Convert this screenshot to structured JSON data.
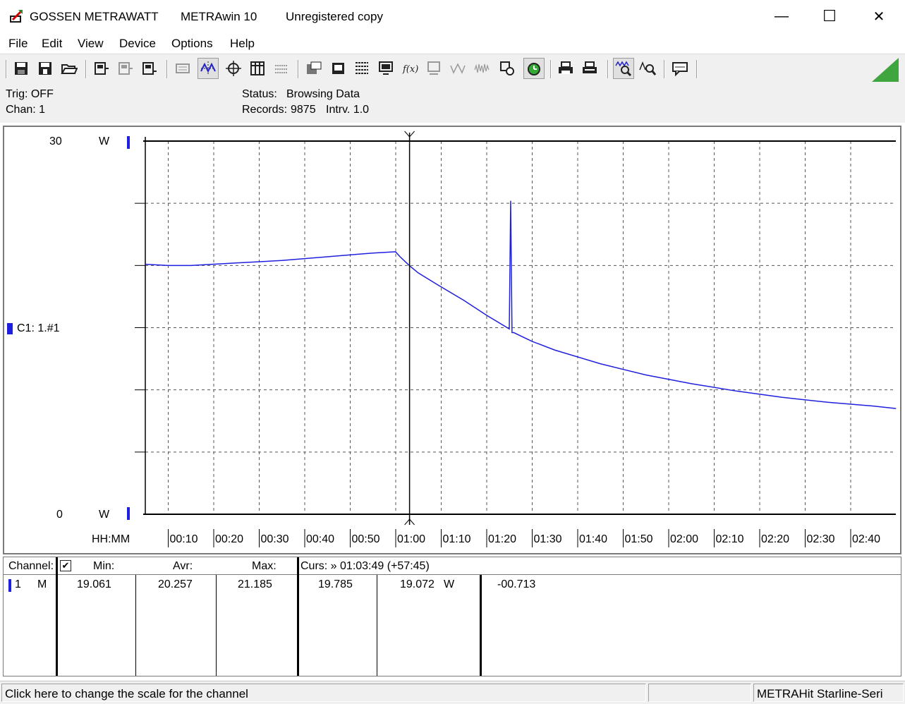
{
  "window": {
    "brand": "GOSSEN METRAWATT",
    "app_name": "METRAwin 10",
    "registration": "Unregistered copy",
    "minimize_glyph": "—",
    "maximize_glyph": "☐",
    "close_glyph": "✕"
  },
  "menu": [
    "File",
    "Edit",
    "View",
    "Device",
    "Options",
    "Help"
  ],
  "toolbar_icons": [
    "save-icon",
    "save-as-icon",
    "open-folder-icon",
    "device-read-icon",
    "device-write-icon",
    "device-config-icon",
    "display-icon",
    "waveform-icon",
    "crosshair-icon",
    "table-icon",
    "list-icon",
    "chart-config-icon",
    "window-icon",
    "data-grid-icon",
    "monitor-icon",
    "function-icon",
    "printer-small-icon",
    "wave-icon",
    "noise-icon",
    "settings-icon",
    "clock-gear-icon",
    "print-icon",
    "print-preview-icon",
    "zoom-wave-icon",
    "zoom-icon",
    "comment-icon"
  ],
  "status": {
    "trig": "Trig: OFF",
    "chan": "Chan:  1",
    "status_label": "Status:",
    "status_value": "Browsing Data",
    "records_label": "Records:",
    "records_value": "9875",
    "interval": "Intrv. 1.0"
  },
  "chart_data": {
    "type": "line",
    "y_max_label": "30",
    "y_min_label": "0",
    "y_unit": "W",
    "ylim": [
      0,
      30
    ],
    "channel_label": "C1: 1.#1",
    "x_axis_label": "HH:MM",
    "x_ticks": [
      "00:10",
      "00:20",
      "00:30",
      "00:40",
      "00:50",
      "01:00",
      "01:10",
      "01:20",
      "01:30",
      "01:40",
      "01:50",
      "02:00",
      "02:10",
      "02:20",
      "02:30",
      "02:40"
    ],
    "x_minutes": [
      0,
      5,
      10,
      20,
      30,
      40,
      50,
      55,
      56,
      58,
      60,
      64,
      70,
      75,
      80,
      80.3,
      80.6,
      81,
      85,
      90,
      100,
      110,
      120,
      130,
      140,
      150,
      160,
      165
    ],
    "y_values": [
      20.1,
      20.0,
      20.0,
      20.2,
      20.4,
      20.7,
      21.0,
      21.1,
      20.7,
      20.0,
      19.4,
      18.5,
      17.2,
      16.0,
      14.9,
      25.2,
      14.6,
      14.6,
      13.9,
      13.2,
      12.1,
      11.2,
      10.5,
      9.9,
      9.4,
      9.0,
      8.7,
      8.5
    ],
    "cursor_minutes": 58,
    "grid": true,
    "series_color": "#1f1fdf"
  },
  "table": {
    "headers": {
      "channel": "Channel:",
      "check": "✔",
      "min": "Min:",
      "avr": "Avr:",
      "max": "Max:",
      "cursor": "Curs: » 01:03:49 (+57:45)"
    },
    "row": {
      "channel_no": "1",
      "mode": "M",
      "min": "19.061",
      "avr": "20.257",
      "max": "21.185",
      "cursor_val1": "19.785",
      "cursor_val2": "19.072",
      "unit": "W",
      "delta": "-00.713"
    }
  },
  "statusbar": {
    "hint": "Click here to change the scale for the channel",
    "middle": "",
    "device": "METRAHit Starline-Seri"
  }
}
